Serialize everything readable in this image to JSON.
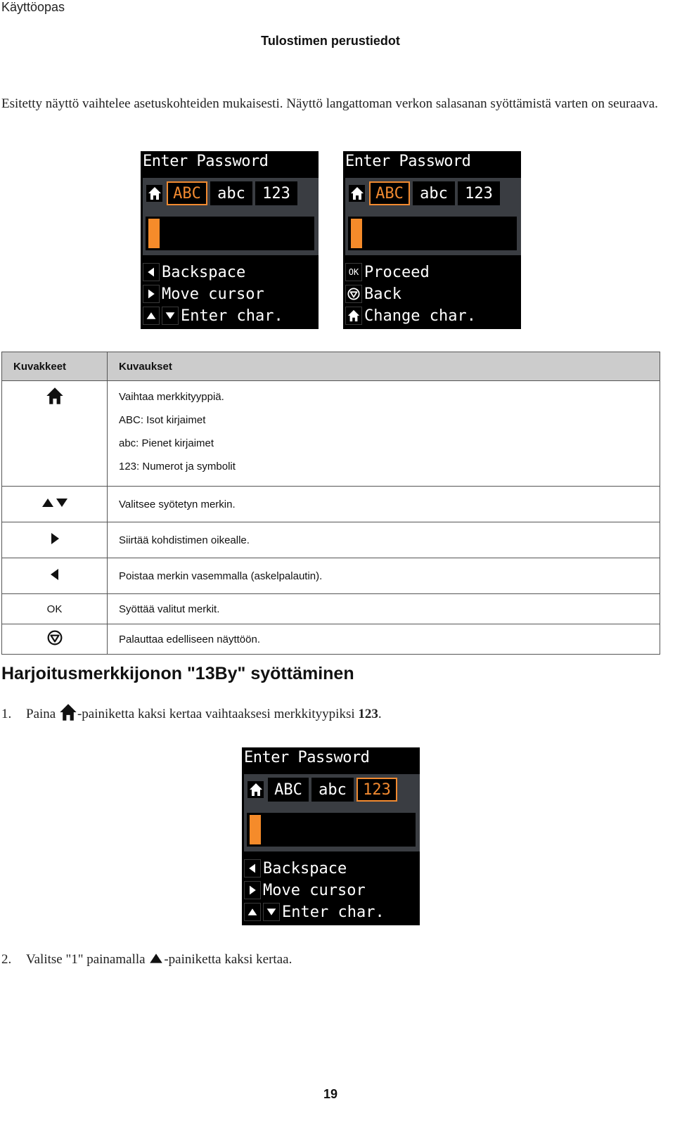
{
  "header": {
    "running_head": "Käyttöopas",
    "section_title": "Tulostimen perustiedot"
  },
  "intro": "Esitetty näyttö vaihtelee asetuskohteiden mukaisesti. Näyttö langattoman verkon salasanan syöttämistä varten on seuraava.",
  "screens": [
    {
      "title": "Enter Password",
      "tabs": [
        "ABC",
        "abc",
        "123"
      ],
      "selected_tab": "ABC",
      "hints": [
        {
          "keys": [
            "left-arrow"
          ],
          "label": "Backspace"
        },
        {
          "keys": [
            "right-arrow"
          ],
          "label": "Move cursor"
        },
        {
          "keys": [
            "up-arrow",
            "down-arrow"
          ],
          "label": "Enter char."
        }
      ]
    },
    {
      "title": "Enter Password",
      "tabs": [
        "ABC",
        "abc",
        "123"
      ],
      "selected_tab": "ABC",
      "hints": [
        {
          "keys": [
            "ok"
          ],
          "key_text": "OK",
          "label": "Proceed"
        },
        {
          "keys": [
            "stop"
          ],
          "label": "Back"
        },
        {
          "keys": [
            "home"
          ],
          "label": "Change char."
        }
      ]
    },
    {
      "title": "Enter Password",
      "tabs": [
        "ABC",
        "abc",
        "123"
      ],
      "selected_tab": "123",
      "hints": [
        {
          "keys": [
            "left-arrow"
          ],
          "label": "Backspace"
        },
        {
          "keys": [
            "right-arrow"
          ],
          "label": "Move cursor"
        },
        {
          "keys": [
            "up-arrow",
            "down-arrow"
          ],
          "label": "Enter char."
        }
      ]
    }
  ],
  "table": {
    "headers": [
      "Kuvakkeet",
      "Kuvaukset"
    ],
    "rows": [
      {
        "icon": "home-icon",
        "lines": [
          "Vaihtaa merkkityyppiä.",
          "ABC: Isot kirjaimet",
          "abc: Pienet kirjaimet",
          "123: Numerot ja symbolit"
        ]
      },
      {
        "icon": "up-down-arrows-icon",
        "lines": [
          "Valitsee syötetyn merkin."
        ]
      },
      {
        "icon": "right-arrow-icon",
        "lines": [
          "Siirtää kohdistimen oikealle."
        ]
      },
      {
        "icon": "left-arrow-icon",
        "lines": [
          "Poistaa merkin vasemmalla (askelpalautin)."
        ]
      },
      {
        "icon": "ok-text",
        "icon_text": "OK",
        "lines": [
          "Syöttää valitut merkit."
        ]
      },
      {
        "icon": "stop-icon",
        "lines": [
          "Palauttaa edelliseen näyttöön."
        ]
      }
    ]
  },
  "practice": {
    "heading": "Harjoitusmerkkijonon \"13By\" syöttäminen",
    "steps": [
      {
        "num": "1.",
        "before": "Paina ",
        "after": "-painiketta kaksi kertaa vaihtaaksesi merkkityypiksi ",
        "bold": "123",
        "end": "."
      },
      {
        "num": "2.",
        "before": "Valitse \"1\" painamalla ",
        "after": "-painiketta kaksi kertaa.",
        "bold": "",
        "end": ""
      }
    ]
  },
  "colors": {
    "accent_orange": "#f58b2a",
    "lcd_band": "#3a3d42",
    "table_header": "#cccccc"
  },
  "footer": {
    "page_number": "19"
  }
}
